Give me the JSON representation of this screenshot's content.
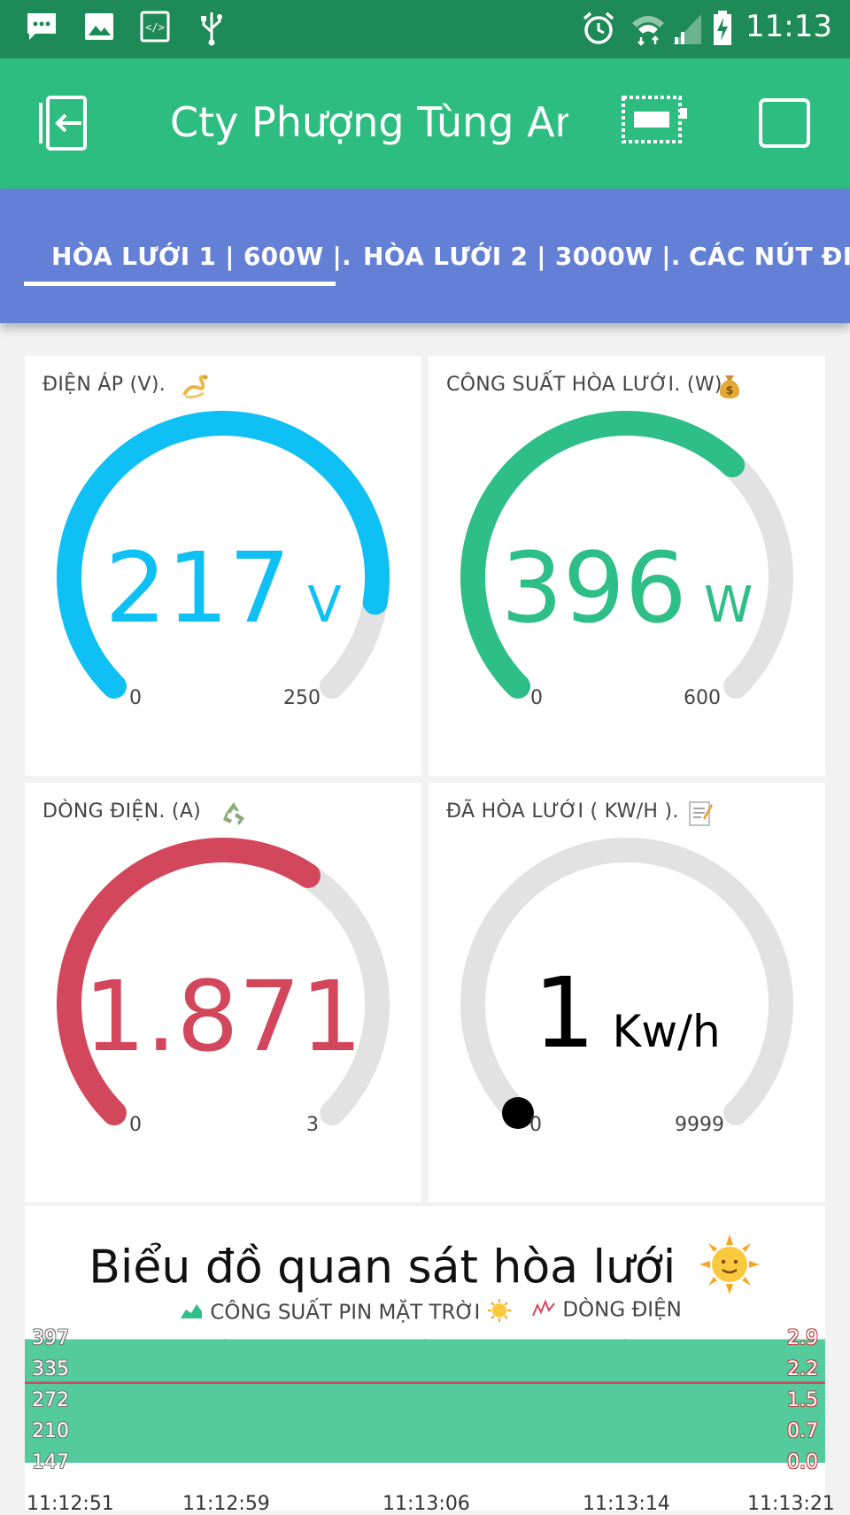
{
  "status_bar": {
    "time": "11:13",
    "icons": [
      "message-icon",
      "image-icon",
      "code-icon",
      "usb-icon",
      "alarm-icon",
      "wifi-icon",
      "signal-icon",
      "battery-charging-icon"
    ]
  },
  "app_bar": {
    "title": "Cty Phượng Tùng Anh",
    "left_icon": "exit-icon",
    "right_icons": [
      "device-icon",
      "square-icon"
    ]
  },
  "tabs": [
    {
      "label": "HÒA LƯỚI 1 | 600W |.",
      "active": true
    },
    {
      "label": "HÒA LƯỚI 2 | 3000W |.",
      "active": false
    },
    {
      "label": "CÁC NÚT ĐIỀU",
      "active": false
    }
  ],
  "gauges": [
    {
      "label": "ĐIỆN ÁP (V).",
      "emoji": "dragon-icon",
      "value": "217",
      "unit": "V",
      "min": "0",
      "max": "250",
      "level": 0.868,
      "color": "#0fc0f5"
    },
    {
      "label": "CÔNG SUẤT HÒA LƯỚI.  (W)",
      "emoji": "money-bag-icon",
      "value": "396",
      "unit": "W",
      "min": "0",
      "max": "600",
      "level": 0.66,
      "color": "#2dbf87"
    },
    {
      "label": "DÒNG ĐIỆN.  (A)",
      "emoji": "recycle-icon",
      "value": "1.871",
      "unit": "",
      "min": "0",
      "max": "3",
      "level": 0.624,
      "color": "#d2475c"
    },
    {
      "label": "ĐÃ HÒA LƯỚI ( KW/H ).",
      "emoji": "memo-icon",
      "value": "1",
      "unit": "Kw/h",
      "min": "0",
      "max": "9999",
      "level": 0.0001,
      "color": "#000000"
    }
  ],
  "chart": {
    "title": "Biểu đồ quan sát hòa lưới",
    "title_emoji": "sun-icon",
    "legend": [
      {
        "label": "CÔNG SUẤT PIN MẶT TRỜI",
        "emoji": "sun-icon",
        "color": "#2dbf87"
      },
      {
        "label": "DÒNG ĐIỆN",
        "color": "#d2475c"
      }
    ]
  },
  "chart_data": {
    "type": "area",
    "x": [
      "11:12:51",
      "11:12:59",
      "11:13:06",
      "11:13:14",
      "11:13:21"
    ],
    "y_left_ticks": [
      "397",
      "335",
      "272",
      "210",
      "147"
    ],
    "y_right_ticks": [
      "2.9",
      "2.2",
      "1.5",
      "0.7",
      "0.0"
    ],
    "series": [
      {
        "name": "CÔNG SUẤT PIN MẶT TRỜI",
        "type": "area",
        "axis": "left",
        "color": "#2dbf87",
        "values": [
          396,
          396,
          396,
          396,
          396
        ]
      },
      {
        "name": "DÒNG ĐIỆN",
        "type": "line",
        "axis": "right",
        "color": "#d2475c",
        "values": [
          1.87,
          1.87,
          1.87,
          1.87,
          1.87
        ]
      }
    ],
    "ylim_left": [
      147,
      397
    ],
    "ylim_right": [
      0.0,
      2.9
    ]
  }
}
